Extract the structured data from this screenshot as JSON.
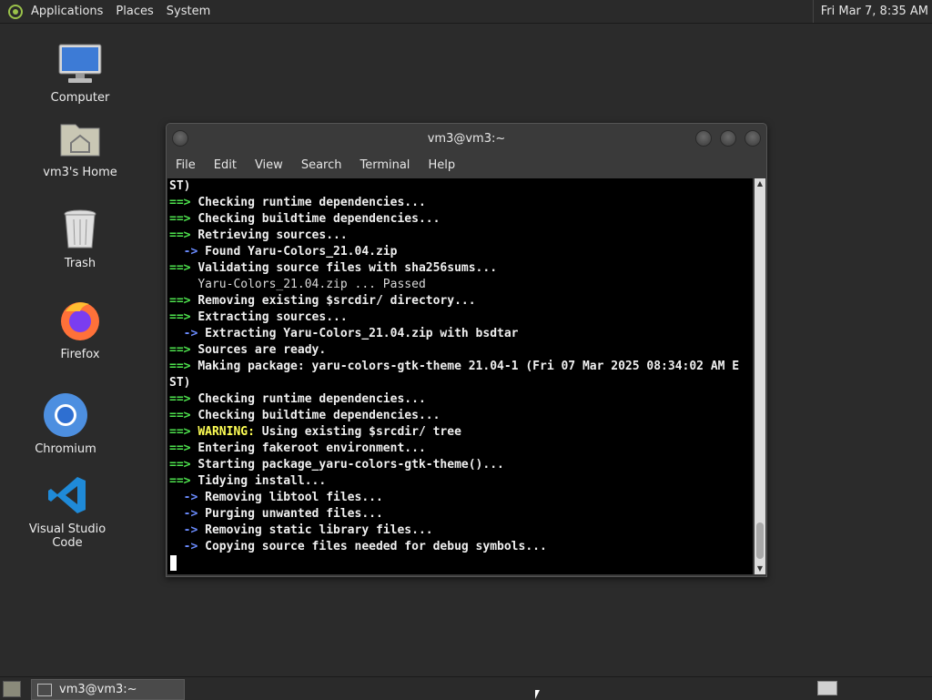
{
  "top_panel": {
    "menus": [
      "Applications",
      "Places",
      "System"
    ],
    "clock": "Fri Mar 7,  8:35 AM"
  },
  "desktop": {
    "icons": [
      {
        "label": "Computer",
        "icon": "computer-icon"
      },
      {
        "label": "vm3's Home",
        "icon": "home-folder-icon"
      },
      {
        "label": "Trash",
        "icon": "trash-icon"
      },
      {
        "label": "Firefox",
        "icon": "firefox-icon"
      },
      {
        "label": "Chromium",
        "icon": "chromium-icon"
      },
      {
        "label": "Visual Studio Code",
        "icon": "vscode-icon"
      }
    ]
  },
  "terminal": {
    "title": "vm3@vm3:~",
    "menu": [
      "File",
      "Edit",
      "View",
      "Search",
      "Terminal",
      "Help"
    ],
    "lines": [
      {
        "prefix": "",
        "text": "ST)"
      },
      {
        "prefix": "==>",
        "text": "Checking runtime dependencies..."
      },
      {
        "prefix": "==>",
        "text": "Checking buildtime dependencies..."
      },
      {
        "prefix": "==>",
        "text": "Retrieving sources..."
      },
      {
        "prefix": "  ->",
        "text": "Found Yaru-Colors_21.04.zip"
      },
      {
        "prefix": "==>",
        "text": "Validating source files with sha256sums..."
      },
      {
        "prefix": "   ",
        "text": "Yaru-Colors_21.04.zip ... Passed",
        "plain": true
      },
      {
        "prefix": "==>",
        "text": "Removing existing $srcdir/ directory..."
      },
      {
        "prefix": "==>",
        "text": "Extracting sources..."
      },
      {
        "prefix": "  ->",
        "text": "Extracting Yaru-Colors_21.04.zip with bsdtar"
      },
      {
        "prefix": "==>",
        "text": "Sources are ready."
      },
      {
        "prefix": "==>",
        "text": "Making package: yaru-colors-gtk-theme 21.04-1 (Fri 07 Mar 2025 08:34:02 AM E"
      },
      {
        "prefix": "",
        "text": "ST)"
      },
      {
        "prefix": "==>",
        "text": "Checking runtime dependencies..."
      },
      {
        "prefix": "==>",
        "text": "Checking buildtime dependencies..."
      },
      {
        "prefix": "==>",
        "warn": "WARNING:",
        "text": "Using existing $srcdir/ tree"
      },
      {
        "prefix": "==>",
        "text": "Entering fakeroot environment..."
      },
      {
        "prefix": "==>",
        "text": "Starting package_yaru-colors-gtk-theme()..."
      },
      {
        "prefix": "==>",
        "text": "Tidying install..."
      },
      {
        "prefix": "  ->",
        "text": "Removing libtool files..."
      },
      {
        "prefix": "  ->",
        "text": "Purging unwanted files..."
      },
      {
        "prefix": "  ->",
        "text": "Removing static library files..."
      },
      {
        "prefix": "  ->",
        "text": "Copying source files needed for debug symbols..."
      }
    ]
  },
  "bottom_panel": {
    "task_label": "vm3@vm3:~"
  },
  "colors": {
    "arrow": "#4ee34e",
    "sub_arrow": "#6b8cff",
    "warning": "#ffff55"
  }
}
